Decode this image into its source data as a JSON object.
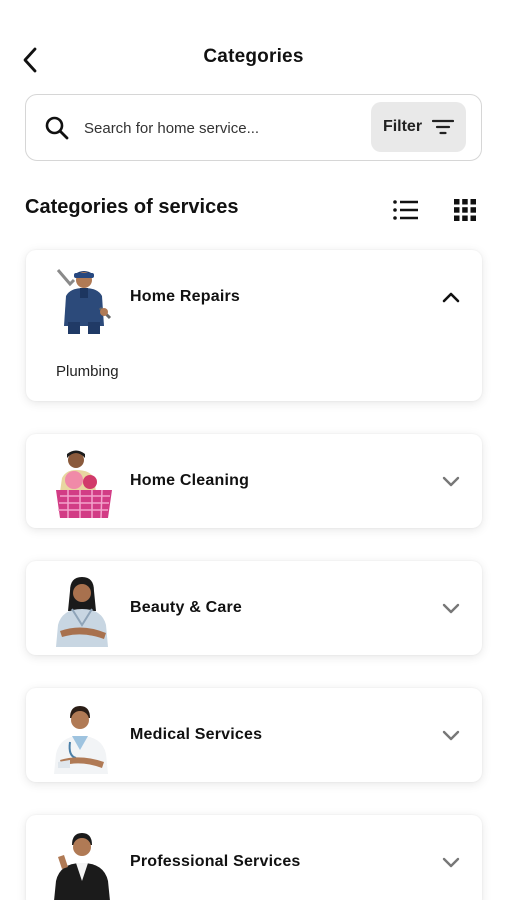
{
  "header": {
    "title": "Categories",
    "back_icon": "chevron-left-icon"
  },
  "search": {
    "placeholder": "Search for home service...",
    "value": "",
    "icon": "search-icon",
    "filter_label": "Filter",
    "filter_icon": "filter-lines-icon"
  },
  "section": {
    "title": "Categories of services",
    "list_icon": "list-view-icon",
    "grid_icon": "grid-view-icon"
  },
  "categories": [
    {
      "name": "Home Repairs",
      "expanded": true,
      "icon": "plumber-photo",
      "subitems": [
        "Plumbing"
      ]
    },
    {
      "name": "Home Cleaning",
      "expanded": false,
      "icon": "cleaner-photo"
    },
    {
      "name": "Beauty & Care",
      "expanded": false,
      "icon": "beautician-photo"
    },
    {
      "name": "Medical Services",
      "expanded": false,
      "icon": "doctor-photo"
    },
    {
      "name": "Professional Services",
      "expanded": false,
      "icon": "lawyer-photo"
    }
  ],
  "colors": {
    "accent": "#111111",
    "card_bg": "#ffffff",
    "filter_bg": "#e9e9e9",
    "chevron_collapsed": "#777777"
  }
}
